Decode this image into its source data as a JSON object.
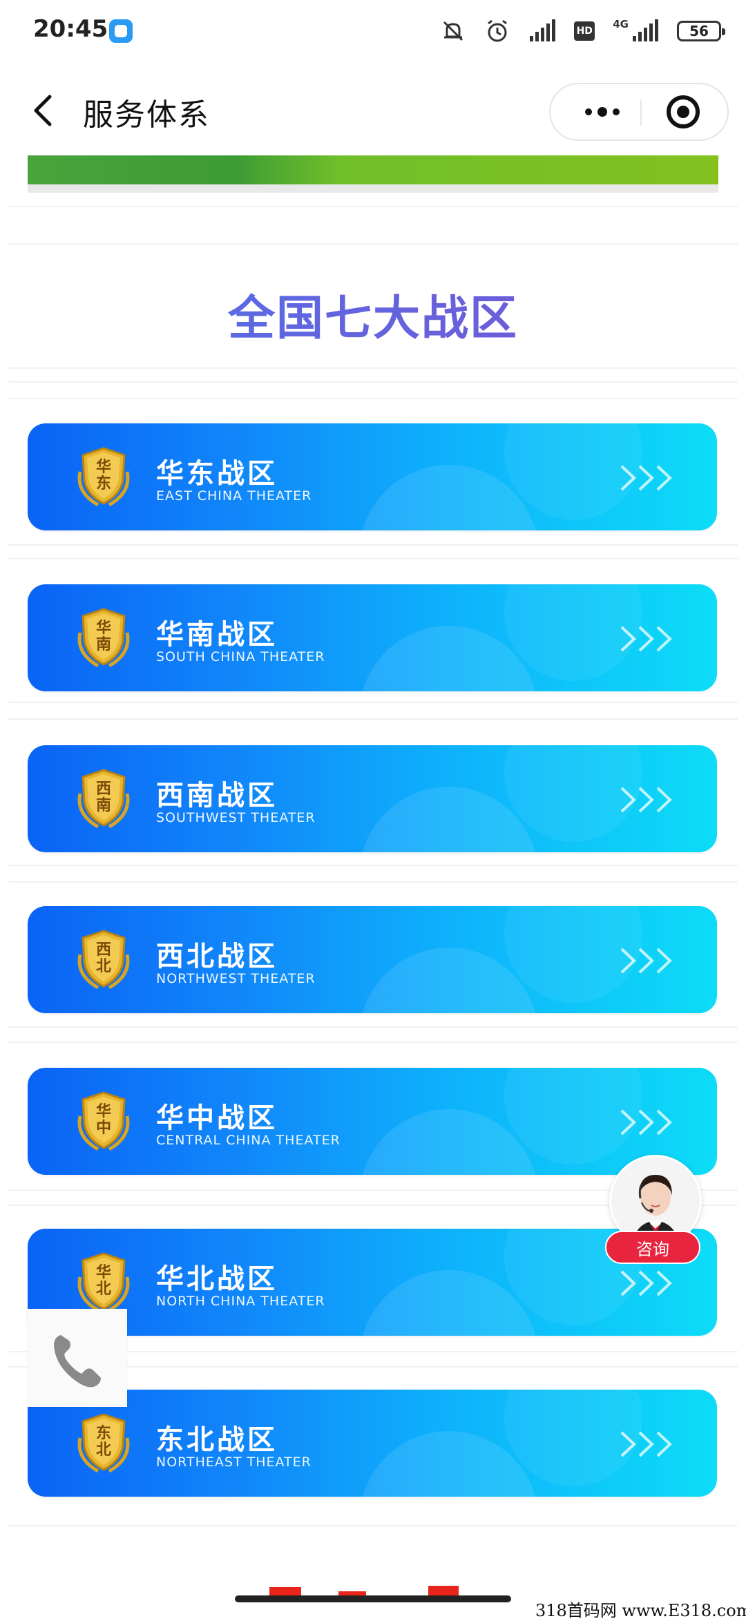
{
  "status_bar": {
    "time": "20:45",
    "network": "4G",
    "hd": "HD",
    "battery": "56"
  },
  "title_bar": {
    "back_icon": "chevron-left-icon",
    "title": "服务体系",
    "more_icon": "more-dots-icon",
    "close_icon": "target-close-icon"
  },
  "section": {
    "title": "全国七大战区"
  },
  "regions": [
    {
      "badge": "华东",
      "title": "华东战区",
      "subtitle": "EAST CHINA THEATER"
    },
    {
      "badge": "华南",
      "title": "华南战区",
      "subtitle": "SOUTH CHINA THEATER"
    },
    {
      "badge": "西南",
      "title": "西南战区",
      "subtitle": "SOUTHWEST THEATER"
    },
    {
      "badge": "西北",
      "title": "西北战区",
      "subtitle": "NORTHWEST THEATER"
    },
    {
      "badge": "华中",
      "title": "华中战区",
      "subtitle": "CENTRAL CHINA THEATER"
    },
    {
      "badge": "华北",
      "title": "华北战区",
      "subtitle": "NORTH CHINA THEATER"
    },
    {
      "badge": "东北",
      "title": "东北战区",
      "subtitle": "NORTHEAST THEATER"
    }
  ],
  "float": {
    "consult_label": "咨询",
    "phone_icon": "phone-icon"
  },
  "watermark": "318首码网 www.E318.com",
  "colors": {
    "card_start": "#0a63f6",
    "card_end": "#0ddcf7",
    "title_gradient_start": "#4d72e8",
    "title_gradient_end": "#7a55d4",
    "consult_red": "#e8243e",
    "badge_gold": "#d9a521"
  }
}
